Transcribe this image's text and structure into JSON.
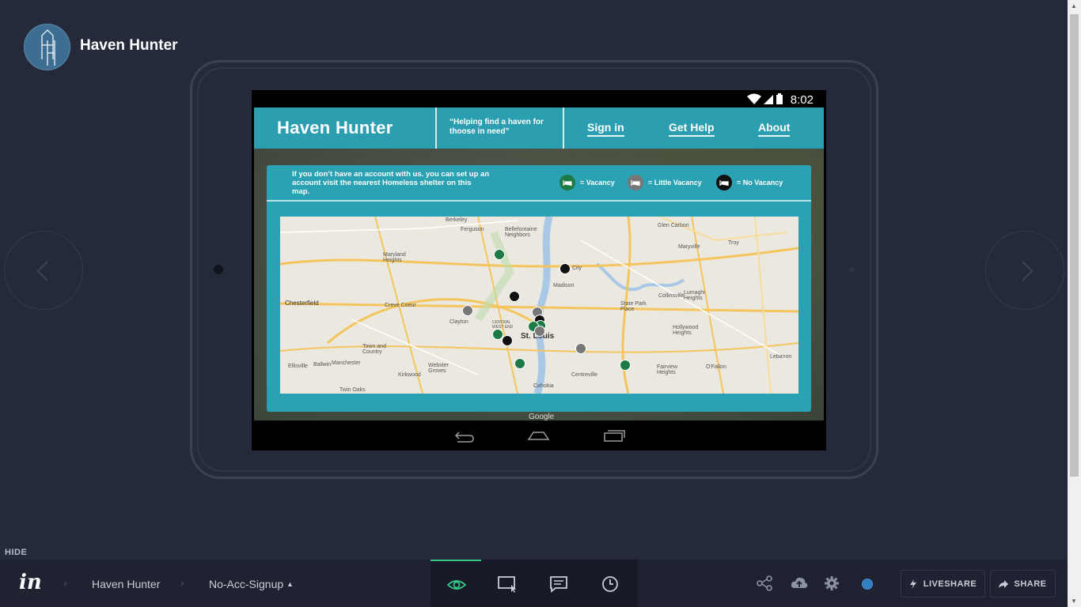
{
  "project": {
    "title": "Haven Hunter"
  },
  "device": {
    "status_time": "8:02"
  },
  "app": {
    "brand": "Haven Hunter",
    "tagline": "“Helping find a haven for thoose in need”",
    "nav": {
      "signin": "Sign in",
      "gethelp": "Get Help",
      "about": "About"
    },
    "note": "If you don’t have an account with us. you can set up an account visit the nearest Homeless shelter on this map.",
    "legend": {
      "vacancy": "= Vacancy",
      "little": "= Little Vacancy",
      "none": "= No Vacancy"
    },
    "map_credit": "Google",
    "colors": {
      "vacancy": "#1d7a45",
      "little": "#777777",
      "none": "#111111",
      "teal": "#2aa2b3"
    },
    "map": {
      "cities": {
        "stlouis": "St. Louis",
        "chesterfield": "Chesterfield",
        "granite": "City"
      },
      "labels": {
        "berkeley": "Berkeley",
        "ferguson": "Ferguson",
        "bellefontaine": "Bellefontaine Neighbors",
        "glencarbon": "Glen Carbon",
        "troy": "Troy",
        "maryville": "Maryville",
        "marylandheights": "Maryland Heights",
        "madison": "Madison",
        "collinsville": "Collinsville",
        "lumaghi": "Lumaghi Heights",
        "crevecoeur": "Creve Coeur",
        "clayton": "Clayton",
        "centralwestend": "CENTRAL WEST END",
        "stateparkplace": "State Park Place",
        "hollywood": "Hollywood Heights",
        "towncountry": "Town and Country",
        "ballwin": "Ballwin",
        "manchester": "Manchester",
        "ellisville": "Ellisville",
        "kirkwood": "Kirkwood",
        "webstergroves": "Webster Groves",
        "centreville": "Centreville",
        "fairview": "Fairview Heights",
        "ofallon": "O'Fallon",
        "lebanon": "Lebanon",
        "twinoaks": "Twin Oaks",
        "cahokia": "Cahokia"
      }
    }
  },
  "bottombar": {
    "hide": "HIDE",
    "crumb_project": "Haven Hunter",
    "crumb_screen": "No-Acc-Signup",
    "liveshare": "LIVESHARE",
    "share": "SHARE"
  },
  "icons": {
    "eye": "eye-icon",
    "rect": "inspect-icon",
    "comment": "comment-icon",
    "history": "history-icon",
    "share": "share-icon",
    "cloud": "cloud-upload-icon",
    "gear": "gear-icon",
    "bolt": "lightning-icon",
    "arrow": "share-arrow-icon"
  }
}
